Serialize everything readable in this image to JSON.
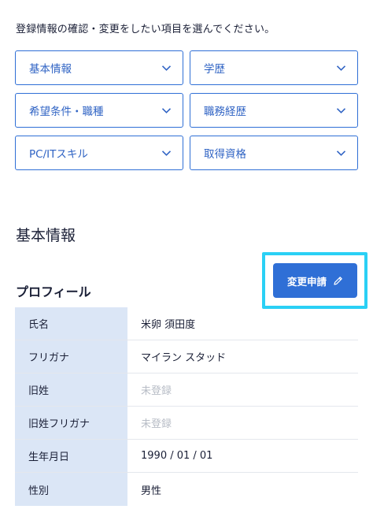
{
  "instruction": "登録情報の確認・変更をしたい項目を選んでください。",
  "menu": [
    {
      "label": "基本情報"
    },
    {
      "label": "学歴"
    },
    {
      "label": "希望条件・職種"
    },
    {
      "label": "職務経歴"
    },
    {
      "label": "PC/ITスキル"
    },
    {
      "label": "取得資格"
    }
  ],
  "section_title": "基本情報",
  "profile": {
    "heading": "プロフィール",
    "edit_button_label": "変更申請",
    "rows": [
      {
        "label": "氏名",
        "value": "米卵 須田度"
      },
      {
        "label": "フリガナ",
        "value": "マイラン スタッド"
      },
      {
        "label": "旧姓",
        "value": "未登録"
      },
      {
        "label": "旧姓フリガナ",
        "value": "未登録"
      },
      {
        "label": "生年月日",
        "value": "1990 / 01 / 01"
      },
      {
        "label": "性別",
        "value": "男性"
      }
    ]
  },
  "colors": {
    "accent": "#2f6fd6",
    "highlight": "#2ad0f5",
    "header_cell_bg": "#dbe6f6",
    "placeholder_text": "#b7bcc6"
  },
  "icons": {
    "menu_chevron": "chevron-down-icon",
    "edit": "pencil-icon"
  }
}
